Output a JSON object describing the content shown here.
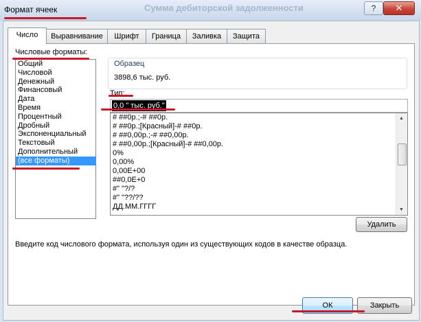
{
  "window": {
    "title": "Формат ячеек",
    "background_title": "Сумма дебиторской задолженности",
    "help_label": "?",
    "close_label": "✕"
  },
  "tabs": [
    {
      "label": "Число",
      "active": true
    },
    {
      "label": "Выравнивание"
    },
    {
      "label": "Шрифт"
    },
    {
      "label": "Граница"
    },
    {
      "label": "Заливка"
    },
    {
      "label": "Защита"
    }
  ],
  "number_formats": {
    "label": "Числовые форматы:",
    "items": [
      "Общий",
      "Числовой",
      "Денежный",
      "Финансовый",
      "Дата",
      "Время",
      "Процентный",
      "Дробный",
      "Экспоненциальный",
      "Текстовый",
      "Дополнительный",
      "(все форматы)"
    ],
    "selected": "(все форматы)"
  },
  "sample": {
    "label": "Образец",
    "value": "3898,6 тыс. руб."
  },
  "type": {
    "label": "Тип:",
    "value": "0,0 \" тыс. руб.\""
  },
  "format_list": [
    "# ##0р.;-# ##0р.",
    "# ##0р.;[Красный]-# ##0р.",
    "# ##0,00р.;-# ##0,00р.",
    "# ##0,00р.;[Красный]-# ##0,00р.",
    "0%",
    "0,00%",
    "0,00E+00",
    "##0,0E+0",
    "#\" \"?/?",
    "#\" \"??/??",
    "ДД.ММ.ГГГГ"
  ],
  "buttons": {
    "delete": "Удалить",
    "ok": "ОК",
    "close": "Закрыть"
  },
  "hint": "Введите код числового формата, используя один из существующих кодов в качестве образца.",
  "colors": {
    "annotation_red": "#c8182b",
    "selection_blue": "#3399ff"
  }
}
